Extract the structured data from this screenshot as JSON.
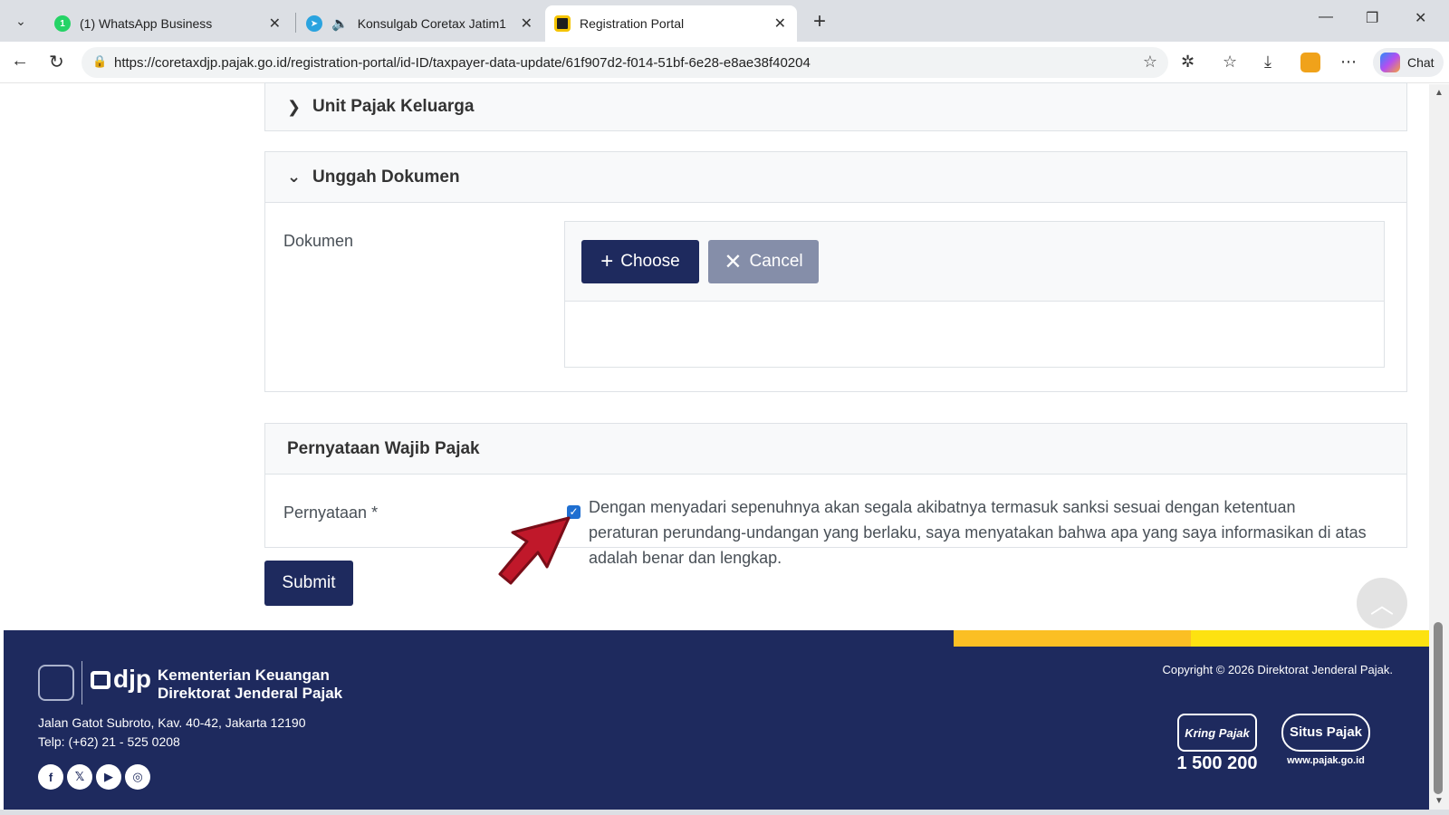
{
  "browser": {
    "tabs": [
      {
        "label": "(1) WhatsApp Business",
        "icon": "whatsapp-icon",
        "color": "#25d366",
        "badge": "1"
      },
      {
        "label": "Konsulgab Coretax Jatim1",
        "icon": "telegram-icon",
        "color": "#2aa3df"
      },
      {
        "label": "Registration Portal",
        "icon": "portal-icon",
        "color": "#f5c400",
        "active": true
      }
    ],
    "url": "https://coretaxdjp.pajak.go.id/registration-portal/id-ID/taxpayer-data-update/61f907d2-f014-51bf-6e28-e8ae38f40204",
    "chat_label": "Chat"
  },
  "sections": {
    "unit_pajak": {
      "title": "Unit Pajak Keluarga"
    },
    "unggah": {
      "title": "Unggah Dokumen",
      "field_label": "Dokumen",
      "choose_label": "Choose",
      "cancel_label": "Cancel"
    },
    "pernyataan": {
      "title": "Pernyataan Wajib Pajak",
      "field_label": "Pernyataan *",
      "checked": true,
      "statement": "Dengan menyadari sepenuhnya akan segala akibatnya termasuk sanksi sesuai dengan ketentuan peraturan perundang-undangan yang berlaku, saya menyatakan bahwa apa yang saya informasikan di atas adalah benar dan lengkap."
    }
  },
  "submit_label": "Submit",
  "footer": {
    "logo_text": "djp",
    "org_line1": "Kementerian Keuangan",
    "org_line2": "Direktorat Jenderal Pajak",
    "address": "Jalan Gatot Subroto, Kav. 40-42, Jakarta 12190",
    "phone": "Telp: (+62) 21 - 525 0208",
    "copyright": "Copyright © 2026 Direktorat Jenderal Pajak.",
    "kring_label": "Kring Pajak",
    "kring_number": "1 500 200",
    "situs_label": "Situs Pajak",
    "situs_web": "www.pajak.go.id",
    "socials": [
      "facebook-icon",
      "x-icon",
      "youtube-icon",
      "instagram-icon"
    ]
  },
  "colors": {
    "primary": "#1e2a5e",
    "secondary": "#858ea9",
    "accent_yellow": "#fbbf24",
    "arrow_red": "#c0182a"
  }
}
